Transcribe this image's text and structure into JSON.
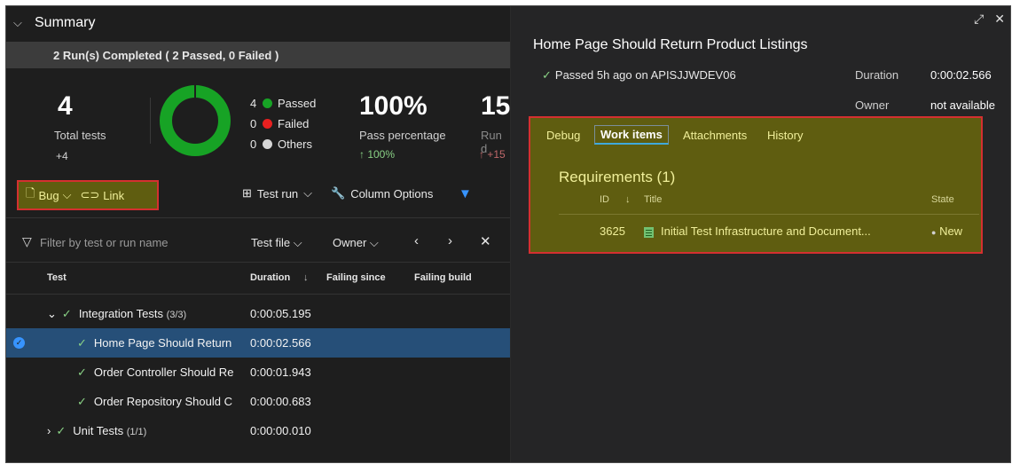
{
  "summary": {
    "title": "Summary",
    "run_status": "2 Run(s) Completed ( 2 Passed, 0 Failed )",
    "total_tests": "4",
    "total_label": "Total tests",
    "total_delta": "+4",
    "legend": [
      {
        "count": "4",
        "label": "Passed",
        "color": "#17a325"
      },
      {
        "count": "0",
        "label": "Failed",
        "color": "#e82020"
      },
      {
        "count": "0",
        "label": "Others",
        "color": "#d6d6d6"
      }
    ],
    "pass_pct": "100%",
    "pass_label": "Pass percentage",
    "pass_delta": "↑ 100%",
    "run_partial": "15",
    "run_label_partial": "Run d",
    "run_delta_partial": "↑ +15"
  },
  "toolbar": {
    "bug": "Bug",
    "link": "Link",
    "test_run": "Test run",
    "column_options": "Column Options"
  },
  "filter": {
    "placeholder": "Filter by test or run name",
    "test_file": "Test file",
    "owner": "Owner"
  },
  "columns": {
    "test": "Test",
    "duration": "Duration",
    "failing_since": "Failing since",
    "failing_build": "Failing build"
  },
  "rows": [
    {
      "name": "Integration Tests",
      "count": "(3/3)",
      "duration": "0:00:05.195"
    },
    {
      "name": "Home Page Should Return",
      "duration": "0:00:02.566"
    },
    {
      "name": "Order Controller Should Re",
      "duration": "0:00:01.943"
    },
    {
      "name": "Order Repository Should C",
      "duration": "0:00:00.683"
    },
    {
      "name": "Unit Tests",
      "count": "(1/1)",
      "duration": "0:00:00.010"
    }
  ],
  "detail": {
    "title": "Home Page Should Return Product Listings",
    "status": "Passed 5h ago on APISJJWDEV06",
    "duration_label": "Duration",
    "duration_value": "0:00:02.566",
    "owner_label": "Owner",
    "owner_value": "not available",
    "tabs": [
      "Debug",
      "Work items",
      "Attachments",
      "History"
    ],
    "requirements_title": "Requirements (1)",
    "wi_columns": {
      "id": "ID",
      "title": "Title",
      "state": "State"
    },
    "work_item": {
      "id": "3625",
      "title": "Initial Test Infrastructure and Document...",
      "state": "New"
    }
  },
  "colors": {
    "passed": "#17a325",
    "highlight_fill": "#5f5d10",
    "highlight_border": "#d43030",
    "selected_row": "#264f78"
  }
}
